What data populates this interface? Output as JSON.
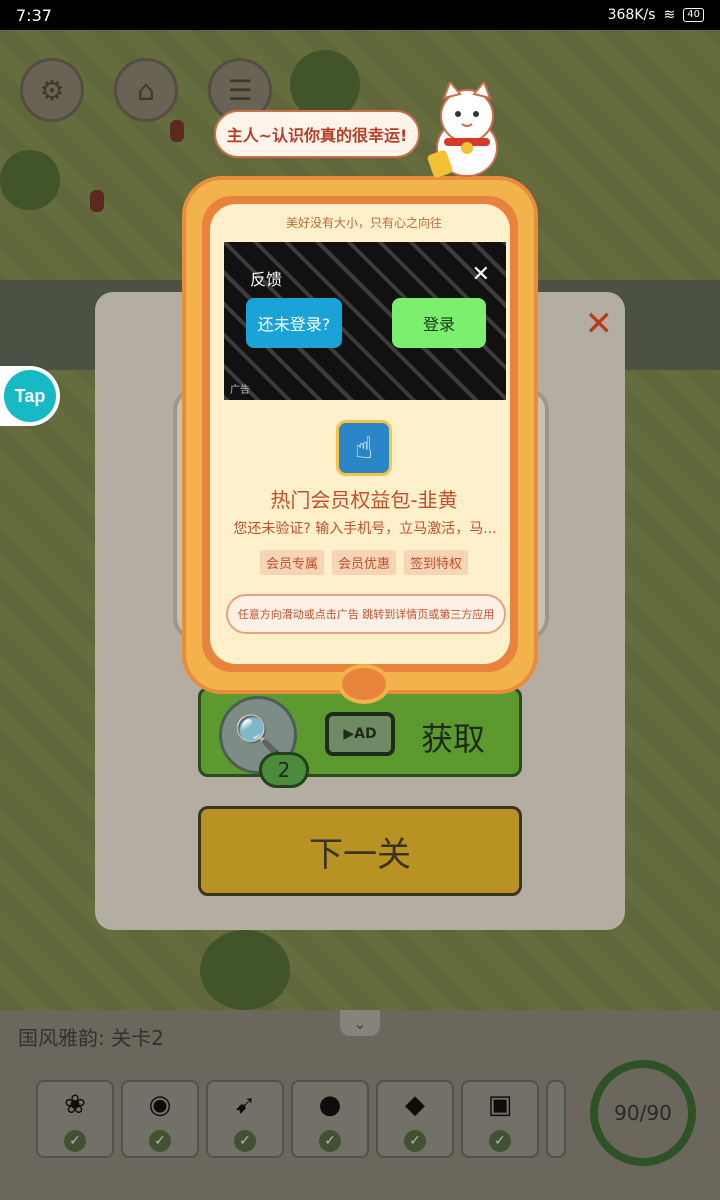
{
  "status_bar": {
    "time": "7:37",
    "speed": "368K/s",
    "battery": "40"
  },
  "game": {
    "level_label": "国风雅韵: 关卡2",
    "counter": "90/90",
    "hint_count": "2",
    "obtain_label": "获取",
    "ad_badge": "AD",
    "next_label": "下一关",
    "speech": "主人~认识你真的很幸运!",
    "tap_badge": "Tap",
    "items": [
      "lotus-icon",
      "sausage-icon",
      "arrow-icon",
      "gourd-icon",
      "lantern-icon",
      "mahjong-tile-icon"
    ]
  },
  "ad": {
    "motto": "美好没有大小，只有心之向往",
    "feedback": "反馈",
    "not_logged_in": "还未登录?",
    "login": "登录",
    "ad_mark": "广告",
    "title": "热门会员权益包-韭黄",
    "description": "您还未验证? 输入手机号，立马激活，马...",
    "tags": [
      "会员专属",
      "会员优惠",
      "签到特权"
    ],
    "swipe_hint": "任意方向滑动或点击广告 跳转到详情页或第三方应用"
  }
}
